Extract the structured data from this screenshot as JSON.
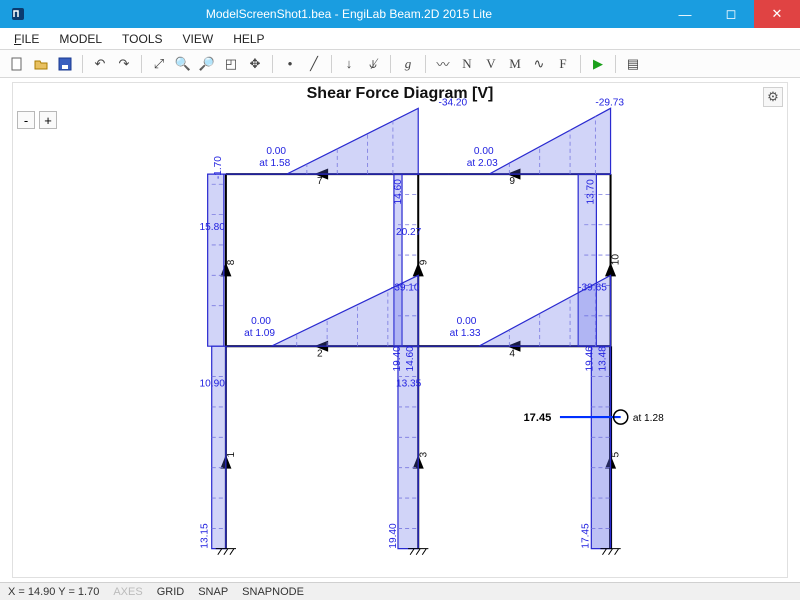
{
  "window": {
    "title": "ModelScreenShot1.bea - EngiLab Beam.2D 2015 Lite"
  },
  "menubar": {
    "file": "FILE",
    "model": "MODEL",
    "tools": "TOOLS",
    "view": "VIEW",
    "help": "HELP"
  },
  "canvas": {
    "title": "Shear Force Diagram [V]",
    "minus": "-",
    "plus": "+"
  },
  "diagram": {
    "columns": {
      "left": {
        "top_v": "-1.70",
        "mid_v": "15.80",
        "base_v": "10.90",
        "bot_v": "13.15",
        "top_elem": "8",
        "bot_elem": "1"
      },
      "mid": {
        "top_v": "14.60",
        "mid_v": "20.27",
        "mid2": "-39.10",
        "base_v1": "19.40",
        "base_v2": "14.60",
        "base_v3": "13.35",
        "bot_v": "19.40",
        "top_elem": "9",
        "bot_elem": "3"
      },
      "right": {
        "top_v": "13.70",
        "mid_v": "-39.65",
        "base_v1": "19.46",
        "base_v2": "13.48",
        "bot_v": "17.45",
        "top_elem": "10",
        "mid_elem": "5",
        "bot_elem": "5"
      }
    },
    "beams": {
      "upper_left": {
        "zero": "0.00",
        "at": "at 1.58",
        "right_end": "-34.20",
        "elem": "7"
      },
      "upper_right": {
        "zero": "0.00",
        "at": "at 2.03",
        "right_end": "-29.73",
        "elem": "9"
      },
      "lower_left": {
        "zero": "0.00",
        "at": "at 1.09",
        "right_end": "-39.10",
        "elem": "2"
      },
      "lower_right": {
        "zero": "0.00",
        "at": "at 1.33",
        "elem": "4"
      }
    },
    "highlight": {
      "value": "17.45",
      "at": "at 1.28"
    }
  },
  "status": {
    "coords": "X = 14.90  Y = 1.70",
    "axes": "AXES",
    "grid": "GRID",
    "snap": "SNAP",
    "snapnode": "SNAPNODE"
  }
}
